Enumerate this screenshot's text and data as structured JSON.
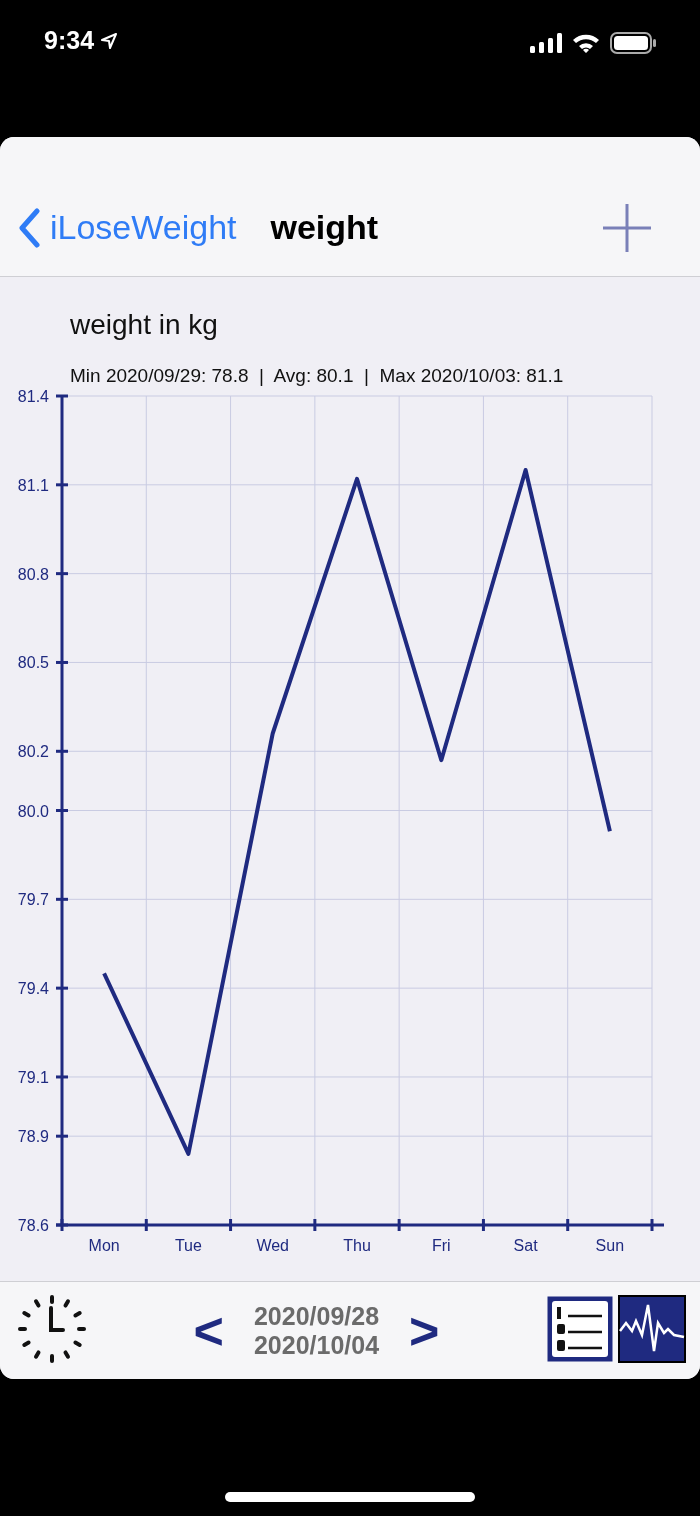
{
  "status_bar": {
    "time": "9:34"
  },
  "nav": {
    "back_label": "iLoseWeight",
    "title": "weight"
  },
  "chart_title": "weight in kg",
  "summary": "Min 2020/09/29: 78.8  |  Avg: 80.1  |  Max 2020/10/03: 81.1",
  "chart_data": {
    "type": "line",
    "grid": true,
    "ylim": [
      78.6,
      81.4
    ],
    "categories": [
      "Mon",
      "Tue",
      "Wed",
      "Thu",
      "Fri",
      "Sat",
      "Sun"
    ],
    "yticks": [
      78.6,
      78.9,
      79.1,
      79.4,
      79.7,
      {
        "value": 80.0,
        "label": "80.0"
      },
      80.2,
      80.5,
      80.8,
      81.1,
      81.4
    ],
    "series": [
      {
        "color": "#1f2a80",
        "values": [
          79.45,
          78.84,
          80.26,
          81.12,
          80.17,
          81.15,
          79.93
        ]
      }
    ]
  },
  "footer": {
    "prev": "<",
    "range_start": "2020/09/28",
    "range_end": "2020/10/04",
    "next": ">"
  }
}
